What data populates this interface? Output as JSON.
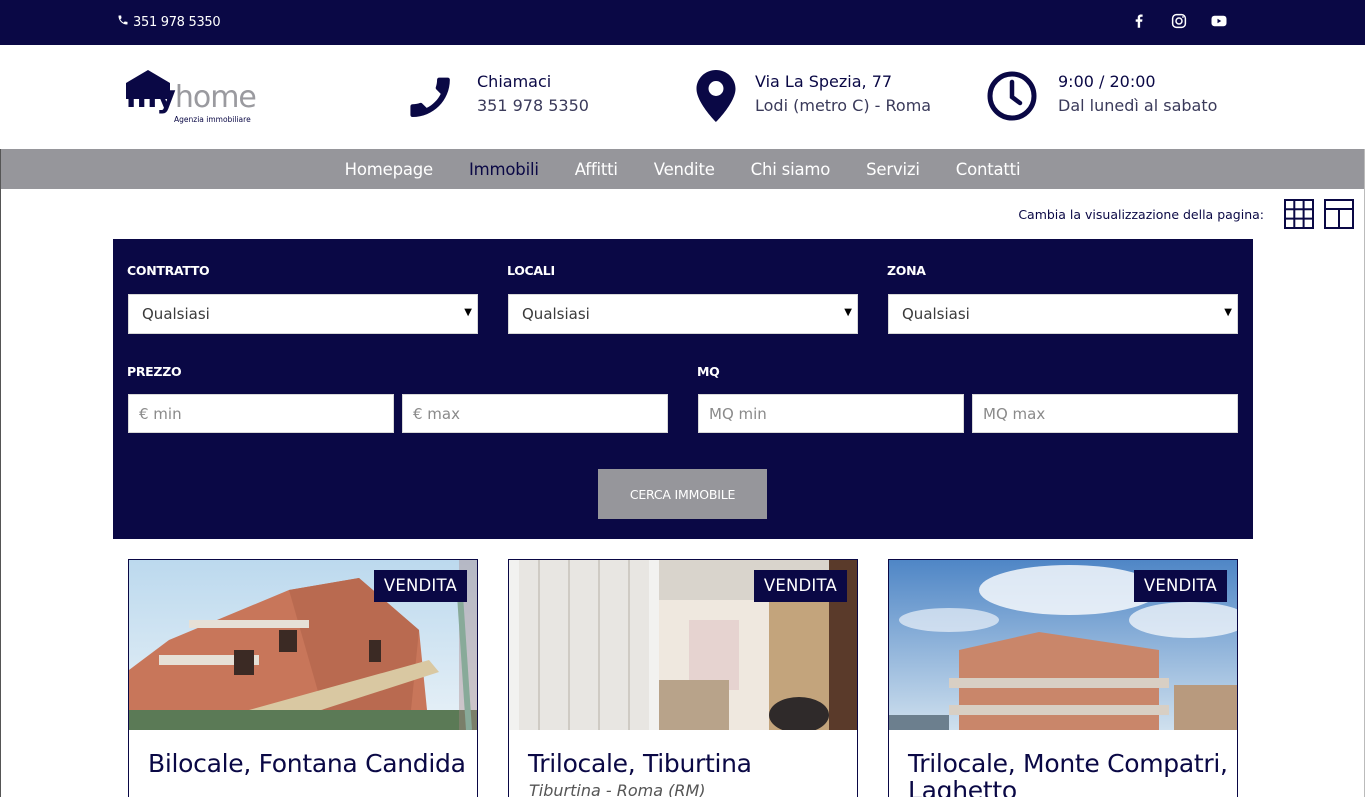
{
  "topbar": {
    "phone": "351 978 5350",
    "social": [
      {
        "icon": "facebook-icon"
      },
      {
        "icon": "instagram-icon"
      },
      {
        "icon": "youtube-icon"
      }
    ]
  },
  "header": {
    "logo": {
      "my": "my",
      "home": "home",
      "tagline": "Agenzia immobiliare"
    },
    "call": {
      "icon": "phone-icon",
      "title": "Chiamaci",
      "value": "351 978 5350"
    },
    "address": {
      "icon": "map-pin-icon",
      "title": "Via La Spezia, 77",
      "value": "Lodi (metro C) - Roma"
    },
    "hours": {
      "icon": "clock-icon",
      "title": "9:00 / 20:00",
      "value": "Dal lunedì al sabato"
    }
  },
  "nav": {
    "items": [
      "Homepage",
      "Immobili",
      "Affitti",
      "Vendite",
      "Chi siamo",
      "Servizi",
      "Contatti"
    ],
    "active": "Immobili"
  },
  "view": {
    "label": "Cambia la visualizzazione della pagina:",
    "options": [
      {
        "icon": "grid-view-icon"
      },
      {
        "icon": "layout-view-icon"
      }
    ]
  },
  "search": {
    "contratto": {
      "label": "CONTRATTO",
      "value": "Qualsiasi"
    },
    "locali": {
      "label": "LOCALI",
      "value": "Qualsiasi"
    },
    "zona": {
      "label": "ZONA",
      "value": "Qualsiasi"
    },
    "prezzo": {
      "label": "PREZZO",
      "min_placeholder": "€ min",
      "max_placeholder": "€ max"
    },
    "mq": {
      "label": "MQ",
      "min_placeholder": "MQ min",
      "max_placeholder": "MQ max"
    },
    "button": "CERCA IMMOBILE"
  },
  "listings": [
    {
      "badge": "VENDITA",
      "title": "Bilocale, Fontana Candida",
      "subtitle": ""
    },
    {
      "badge": "VENDITA",
      "title": "Trilocale, Tiburtina",
      "subtitle": "Tiburtina - Roma  (RM)"
    },
    {
      "badge": "VENDITA",
      "title": "Trilocale, Monte Compatri, Laghetto",
      "subtitle": ""
    }
  ],
  "colors": {
    "primary": "#0a0845",
    "grey": "#96969b",
    "white": "#ffffff"
  }
}
